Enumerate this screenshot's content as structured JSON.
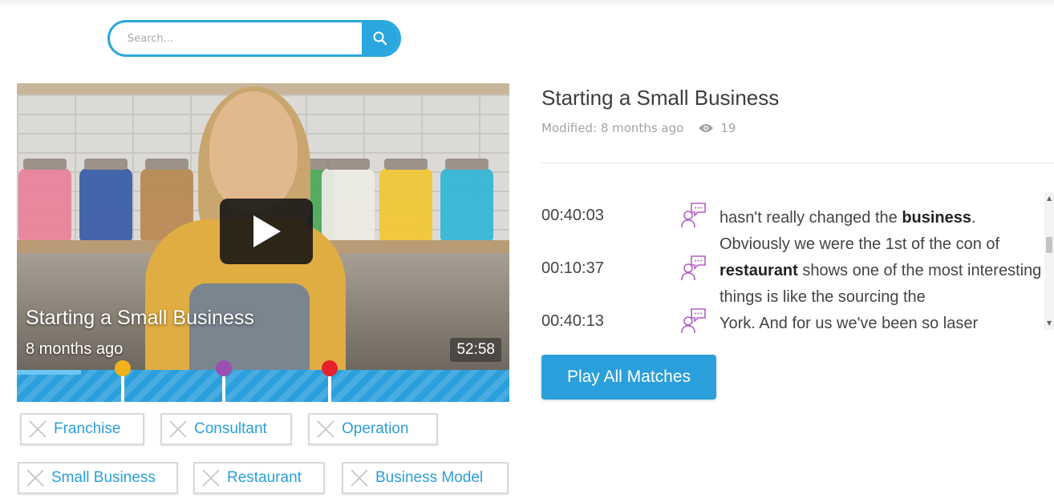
{
  "search": {
    "placeholder": "Search...",
    "icon": "search-icon"
  },
  "video": {
    "title": "Starting a Small Business",
    "age": "8 months ago",
    "duration": "52:58",
    "progress_fraction": 0.13,
    "markers": [
      {
        "color": "#f2b21b",
        "position_fraction": 0.215
      },
      {
        "color": "#9b4fb0",
        "position_fraction": 0.42
      },
      {
        "color": "#e8222a",
        "position_fraction": 0.635
      }
    ]
  },
  "tags": [
    {
      "label": "Franchise"
    },
    {
      "label": "Consultant"
    },
    {
      "label": "Operation"
    },
    {
      "label": "Small Business"
    },
    {
      "label": "Restaurant"
    },
    {
      "label": "Business Model"
    }
  ],
  "details": {
    "title": "Starting a Small Business",
    "modified": "Modified: 8 months ago",
    "views": "19"
  },
  "transcript": [
    {
      "time": "00:40:03",
      "before": "hasn't really changed the ",
      "keyword": "business",
      "after": ". Obviously we were the 1st of the con of"
    },
    {
      "time": "00:10:37",
      "before": "",
      "keyword": "restaurant",
      "after": " shows one of the most interesting things is like the sourcing the"
    },
    {
      "time": "00:40:13",
      "before": "York. And for us we've been so laser",
      "keyword": "",
      "after": ""
    }
  ],
  "actions": {
    "play_all": "Play All Matches"
  },
  "colors": {
    "accent": "#29a7de",
    "speaker_icon": "#b25ec5"
  }
}
